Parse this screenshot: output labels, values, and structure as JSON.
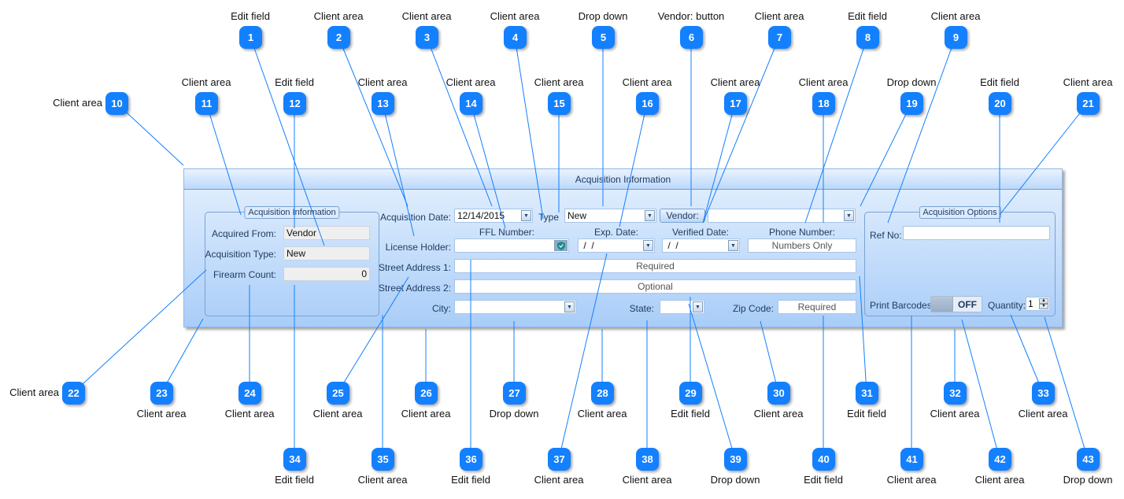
{
  "panel": {
    "title": "Acquisition Information",
    "left_group": {
      "title": "Acquisition Information",
      "acquired_from": {
        "label": "Acquired From:",
        "value": "Vendor"
      },
      "acquisition_type": {
        "label": "Acquisition Type:",
        "value": "New"
      },
      "firearm_count": {
        "label": "Firearm Count:",
        "value": "0"
      }
    },
    "main": {
      "acquisition_date": {
        "label": "Acquisition Date:",
        "value": "12/14/2015",
        "icon": "chevron-down-icon"
      },
      "type": {
        "label": "Type",
        "value": "New",
        "icon": "chevron-down-icon"
      },
      "vendor": {
        "button_label": "Vendor:",
        "value": "",
        "icon": "chevron-down-icon"
      },
      "column_headers": {
        "ffl_number": "FFL Number:",
        "exp_date": "Exp. Date:",
        "verified_date": "Verified Date:",
        "phone_number": "Phone Number:"
      },
      "license_holder": {
        "label": "License Holder:",
        "ffl_value": "",
        "ffl_icon": "shield-check-icon",
        "exp_date_value": " /  /",
        "verified_date_value": " /  /",
        "phone_placeholder": "Numbers Only"
      },
      "street1": {
        "label": "Street Address 1:",
        "placeholder": "Required"
      },
      "street2": {
        "label": "Street Address 2:",
        "placeholder": "Optional"
      },
      "city": {
        "label": "City:",
        "value": ""
      },
      "state": {
        "label": "State:",
        "value": ""
      },
      "zip": {
        "label": "Zip Code:",
        "placeholder": "Required"
      }
    },
    "options_group": {
      "title": "Acquisition Options",
      "ref_no": {
        "label": "Ref No:",
        "value": ""
      },
      "print_barcodes": {
        "label": "Print Barcodes:",
        "state": "OFF"
      },
      "quantity": {
        "label": "Quantity:",
        "value": "1"
      }
    }
  },
  "callouts": [
    {
      "n": "1",
      "label": "Edit field"
    },
    {
      "n": "2",
      "label": "Client area"
    },
    {
      "n": "3",
      "label": "Client area"
    },
    {
      "n": "4",
      "label": "Client area"
    },
    {
      "n": "5",
      "label": "Drop down"
    },
    {
      "n": "6",
      "label": "Vendor: button"
    },
    {
      "n": "7",
      "label": "Client area"
    },
    {
      "n": "8",
      "label": "Edit field"
    },
    {
      "n": "9",
      "label": "Client area"
    },
    {
      "n": "10",
      "label": "Client area"
    },
    {
      "n": "11",
      "label": "Client area"
    },
    {
      "n": "12",
      "label": "Edit field"
    },
    {
      "n": "13",
      "label": "Client area"
    },
    {
      "n": "14",
      "label": "Client area"
    },
    {
      "n": "15",
      "label": "Client area"
    },
    {
      "n": "16",
      "label": "Client area"
    },
    {
      "n": "17",
      "label": "Client area"
    },
    {
      "n": "18",
      "label": "Client area"
    },
    {
      "n": "19",
      "label": "Drop down"
    },
    {
      "n": "20",
      "label": "Edit field"
    },
    {
      "n": "21",
      "label": "Client area"
    },
    {
      "n": "22",
      "label": "Client area"
    },
    {
      "n": "23",
      "label": "Client area"
    },
    {
      "n": "24",
      "label": "Client area"
    },
    {
      "n": "25",
      "label": "Client area"
    },
    {
      "n": "26",
      "label": "Client area"
    },
    {
      "n": "27",
      "label": "Drop down"
    },
    {
      "n": "28",
      "label": "Client area"
    },
    {
      "n": "29",
      "label": "Edit field"
    },
    {
      "n": "30",
      "label": "Client area"
    },
    {
      "n": "31",
      "label": "Edit field"
    },
    {
      "n": "32",
      "label": "Client area"
    },
    {
      "n": "33",
      "label": "Client area"
    },
    {
      "n": "34",
      "label": "Edit field"
    },
    {
      "n": "35",
      "label": "Client area"
    },
    {
      "n": "36",
      "label": "Edit field"
    },
    {
      "n": "37",
      "label": "Client area"
    },
    {
      "n": "38",
      "label": "Client area"
    },
    {
      "n": "39",
      "label": "Drop down"
    },
    {
      "n": "40",
      "label": "Edit field"
    },
    {
      "n": "41",
      "label": "Client area"
    },
    {
      "n": "42",
      "label": "Client area"
    },
    {
      "n": "43",
      "label": "Drop down"
    }
  ],
  "colors": {
    "callout": "#1380ff",
    "leader": "#1380ff",
    "panel_top": "#e6f1fe",
    "panel_bottom": "#a9cdf8"
  }
}
